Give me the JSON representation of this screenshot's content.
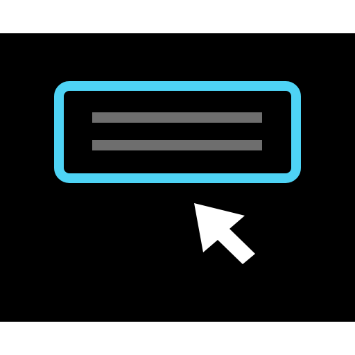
{
  "icon": {
    "subject": "text-input-with-pointer",
    "field_name": "text-field-icon",
    "cursor_name": "mouse-pointer-icon"
  },
  "colors": {
    "background": "#000000",
    "page": "#ffffff",
    "field_border": "#4ed3f5",
    "text_placeholder_lines": "#6e6e6e",
    "cursor": "#ffffff"
  }
}
